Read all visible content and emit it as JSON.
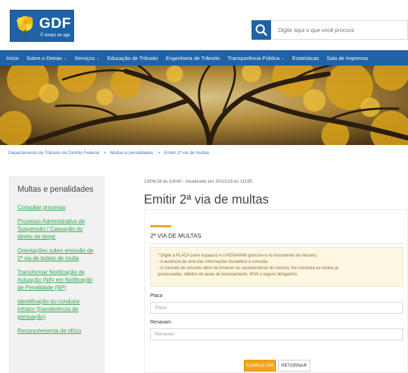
{
  "header": {
    "logo_text": "GDF",
    "logo_tagline": "É tempo de agir.",
    "search_placeholder": "Digite aqui o que você procura"
  },
  "nav": {
    "items": [
      {
        "label": "Início",
        "dropdown": false
      },
      {
        "label": "Sobre o Detran",
        "dropdown": true
      },
      {
        "label": "Serviços",
        "dropdown": true
      },
      {
        "label": "Educação de Trânsito",
        "dropdown": false
      },
      {
        "label": "Engenharia de Trânsito",
        "dropdown": false
      },
      {
        "label": "Transparência Pública",
        "dropdown": true
      },
      {
        "label": "Estatísticas",
        "dropdown": false
      },
      {
        "label": "Sala de Imprensa",
        "dropdown": false
      }
    ],
    "caret": "⌄"
  },
  "breadcrumb": {
    "items": [
      "Departamento de Trânsito do Distrito Federal",
      "Multas e penalidades",
      "Emitir 2ª via de multas"
    ],
    "separator": ">"
  },
  "sidebar": {
    "title": "Multas e penalidades",
    "links": [
      "Consultar processo",
      "Processo Administrativo de Suspensão / Cassação do direito de dirigir",
      "Orientações sobre emissão de 2ª via de boleto de multa",
      "Transformar Notificação de Autuação (NA) em Notificação de Penalidade (NP)",
      "Identificação do condutor infrator (transferência de pontuação)",
      "Recurso/ementa de ofício"
    ]
  },
  "main": {
    "meta": "13/06/18 às 10h40 - Atualizado em 20/11/18 às 11h35",
    "title": "Emitir 2ª via de multas",
    "card_heading": "2ª VIA DE MULTAS",
    "notice": [
      "* Digite a PLACA (sem espaços) e o RENAVAM (procure-o no documento do veículo).",
      "- A ausência de uma das informações inviabiliza a consulta.",
      "- A consulta de veículos além de fornecer as características do mesmo, lhe mostrará as multas já",
      "processadas, débitos de taxas de licenciamento, IPVA e seguro obrigatório."
    ],
    "placa": {
      "label": "Placa",
      "placeholder": "Placa",
      "value": ""
    },
    "renavam": {
      "label": "Renavam",
      "placeholder": "Renavam",
      "value": ""
    },
    "consultar_label": "CONSULTAR",
    "retornar_label": "RETORNAR"
  },
  "colors": {
    "brand_blue": "#1f62a6",
    "accent_orange": "#f4a21c",
    "link_green": "#2fa84a",
    "breadcrumb_blue": "#3a78b9",
    "notice_bg": "#fdf6e0"
  },
  "icons": {
    "search": "search-icon",
    "logo_flower": "ipe-flower-icon"
  }
}
